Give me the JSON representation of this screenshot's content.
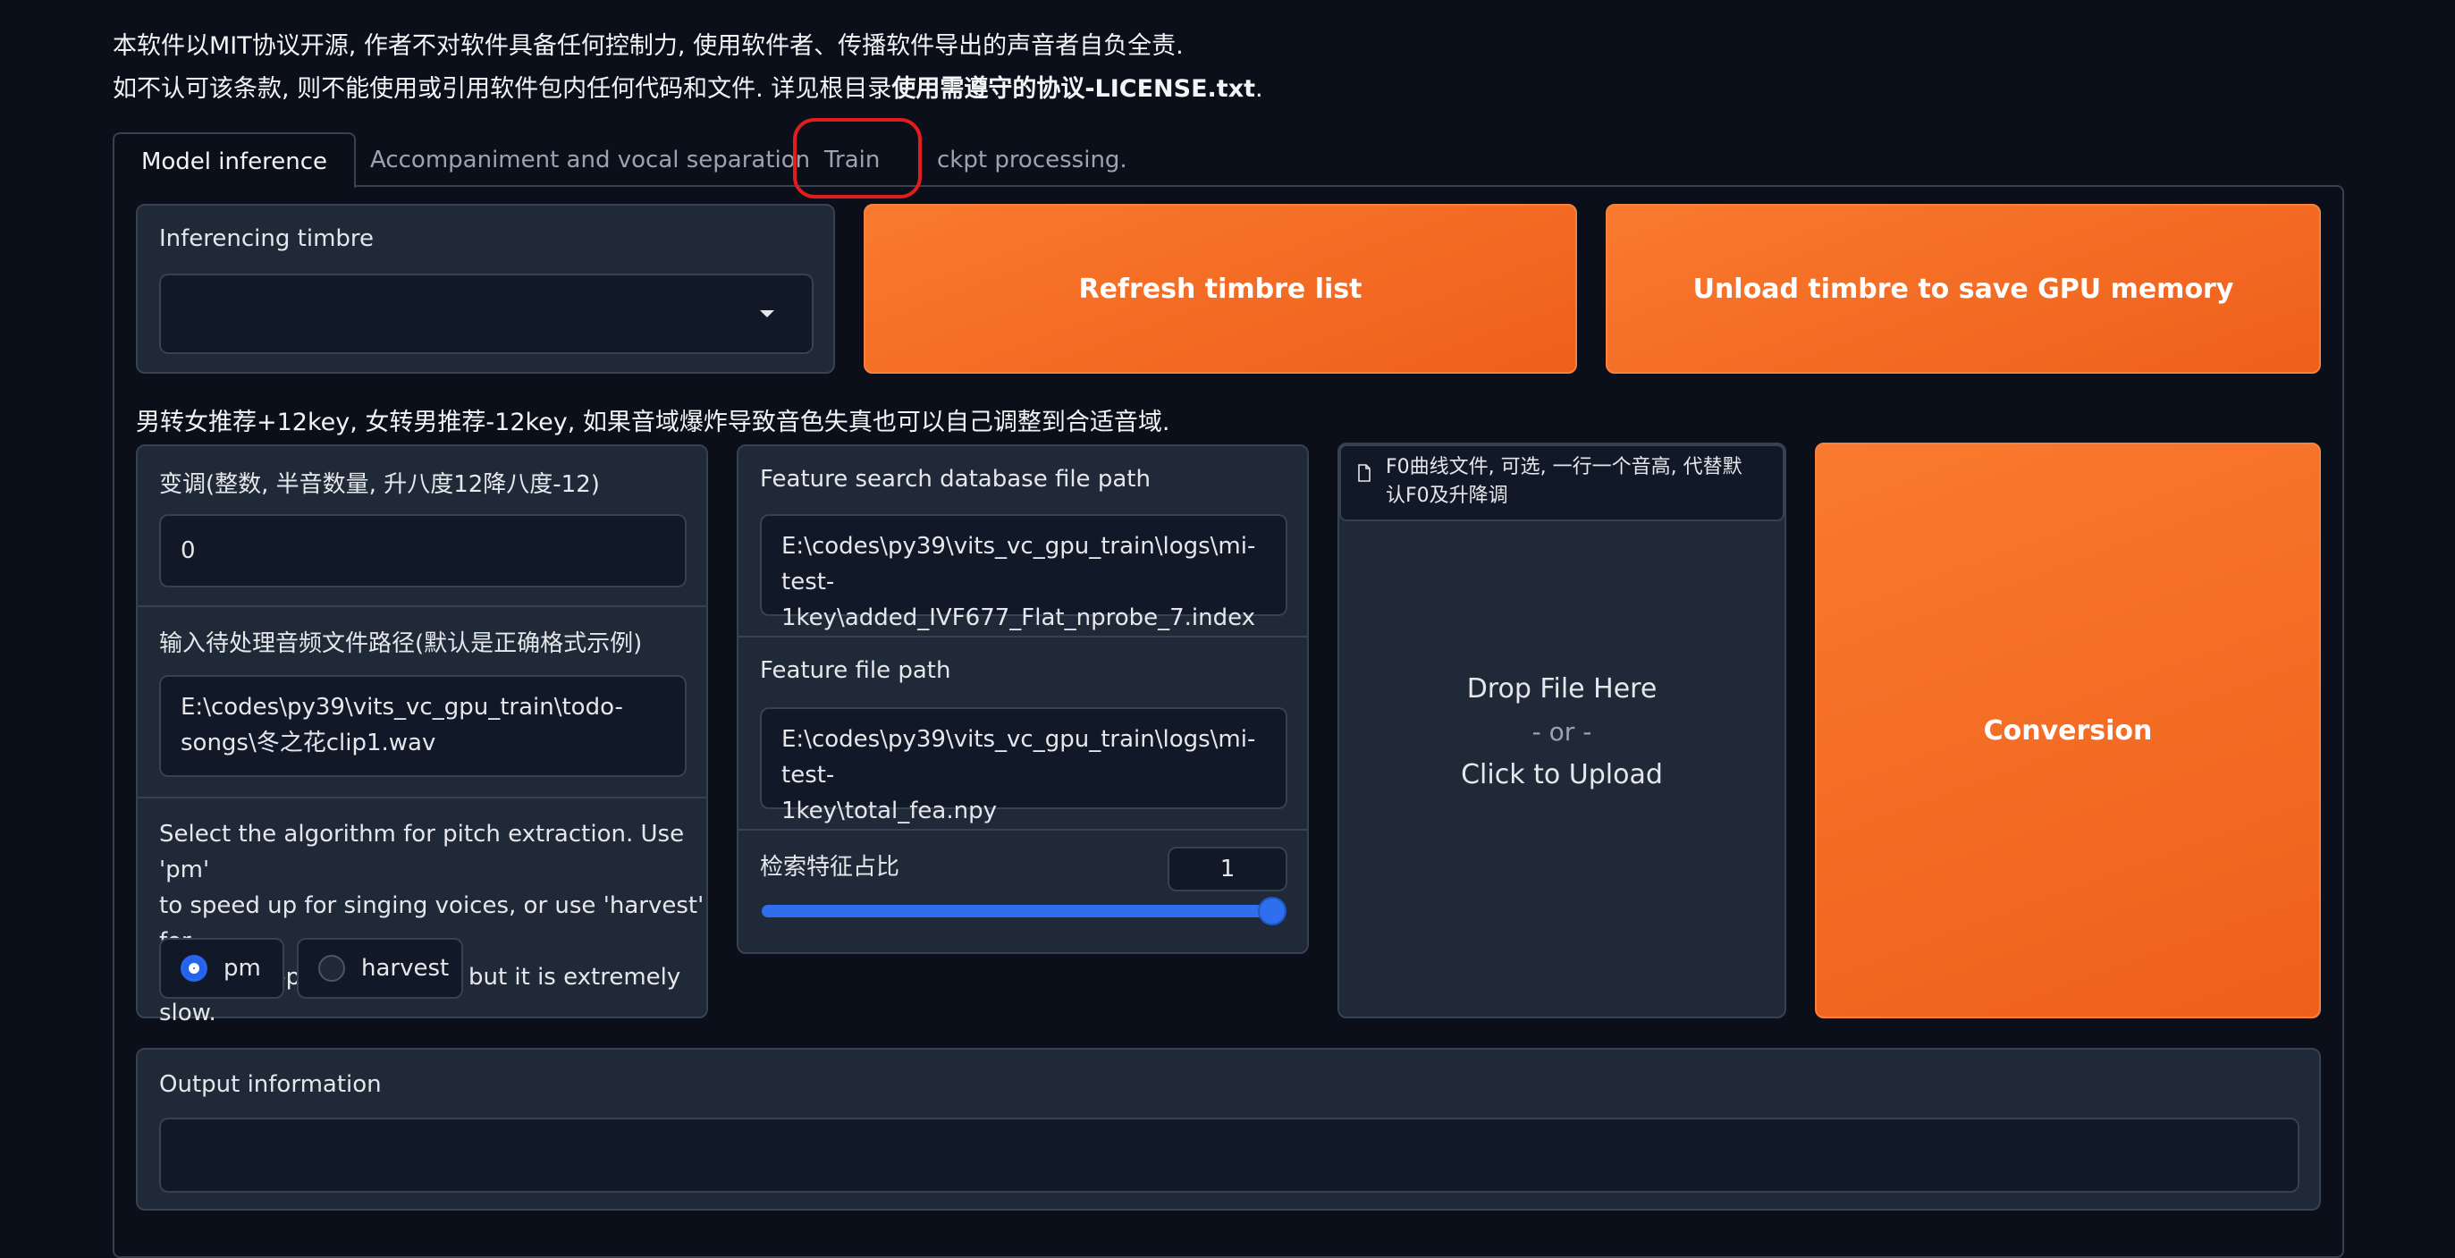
{
  "notice": {
    "line1": "本软件以MIT协议开源, 作者不对软件具备任何控制力, 使用软件者、传播软件导出的声音者自负全责.",
    "line2_prefix": "如不认可该条款, 则不能使用或引用软件包内任何代码和文件. 详见根目录",
    "line2_bold": "使用需遵守的协议-LICENSE.txt",
    "line2_suffix": "."
  },
  "tabs": [
    {
      "label": "Model inference",
      "active": true
    },
    {
      "label": "Accompaniment and vocal separation",
      "active": false
    },
    {
      "label": "Train",
      "active": false,
      "highlighted": true
    },
    {
      "label": "ckpt processing.",
      "active": false
    }
  ],
  "timbre": {
    "label": "Inferencing timbre",
    "value": ""
  },
  "buttons": {
    "refresh": "Refresh timbre list",
    "unload": "Unload timbre to save GPU memory",
    "convert": "Conversion"
  },
  "hint": "男转女推荐+12key, 女转男推荐-12key, 如果音域爆炸导致音色失真也可以自己调整到合适音域.",
  "transpose": {
    "label": "变调(整数, 半音数量, 升八度12降八度-12)",
    "value": "0"
  },
  "input_audio": {
    "label": "输入待处理音频文件路径(默认是正确格式示例)",
    "value_line1": "E:\\codes\\py39\\vits_vc_gpu_train\\todo-",
    "value_line2": "songs\\冬之花clip1.wav"
  },
  "pitch_algo": {
    "label_line1": "Select the algorithm for pitch extraction. Use 'pm'",
    "label_line2": "to speed up for singing voices, or use 'harvest' for",
    "label_line3": "better low-pitched voices, but it is extremely slow.",
    "options": [
      "pm",
      "harvest"
    ],
    "selected": "pm"
  },
  "feature_index": {
    "label": "Feature search database file path",
    "value_line1": "E:\\codes\\py39\\vits_vc_gpu_train\\logs\\mi-test-",
    "value_line2": "1key\\added_IVF677_Flat_nprobe_7.index"
  },
  "feature_file": {
    "label": "Feature file path",
    "value_line1": "E:\\codes\\py39\\vits_vc_gpu_train\\logs\\mi-test-",
    "value_line2": "1key\\total_fea.npy"
  },
  "index_ratio": {
    "label": "检索特征占比",
    "value": "1",
    "fraction": 1.0
  },
  "f0_upload": {
    "label_line1": "F0曲线文件, 可选, 一行一个音高, 代替默",
    "label_line2": "认F0及升降调",
    "drop": "Drop File Here",
    "or": "- or -",
    "click": "Click to Upload"
  },
  "output": {
    "label": "Output information",
    "value": ""
  }
}
